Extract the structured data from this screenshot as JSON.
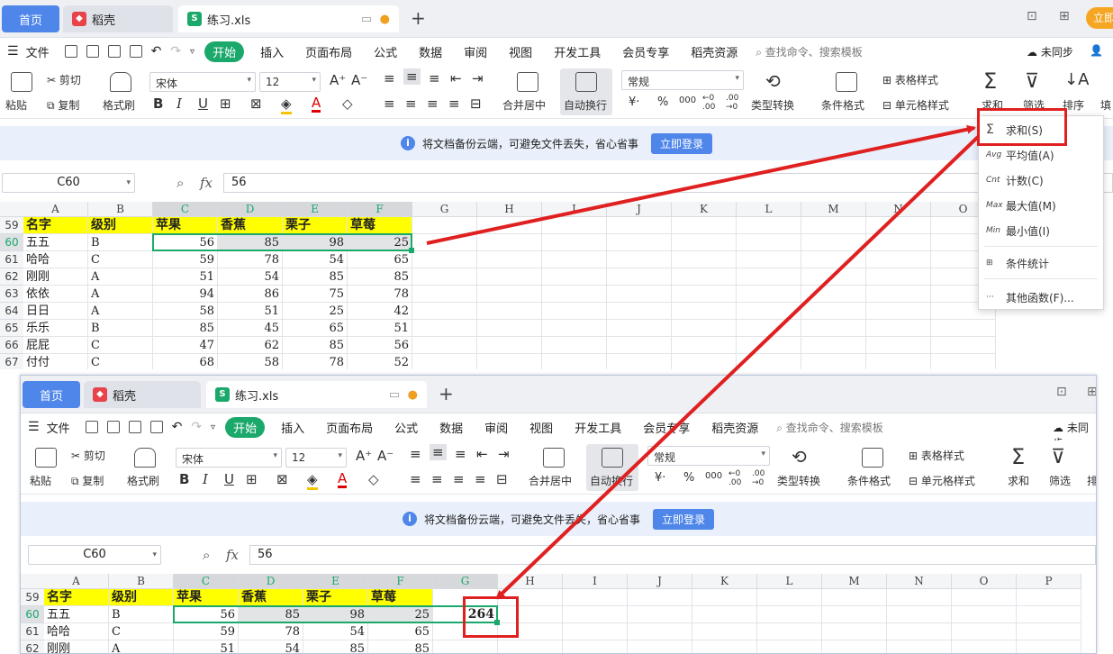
{
  "tabs": {
    "home": "首页",
    "daoke": "稻壳",
    "file": "练习.xls"
  },
  "menu": [
    "文件",
    "开始",
    "插入",
    "页面布局",
    "公式",
    "数据",
    "审阅",
    "视图",
    "开发工具",
    "会员专享",
    "稻壳资源"
  ],
  "menu_search": "查找命令、搜索模板",
  "sync_label": "未同步",
  "login_top": "立即",
  "ribbon": {
    "paste": "粘贴",
    "cut": "剪切",
    "copy": "复制",
    "format_painter": "格式刷",
    "font_name": "宋体",
    "font_size": "12",
    "merge_center": "合并居中",
    "wrap_text": "自动换行",
    "number_format": "常规",
    "type_convert": "类型转换",
    "cond_format": "条件格式",
    "table_style": "表格样式",
    "cell_style": "单元格样式",
    "sum": "求和",
    "filter": "筛选",
    "sort": "排序",
    "fill": "填"
  },
  "notice": {
    "text": "将文档备份云端，可避免文件丢失，省心省事",
    "button": "立即登录"
  },
  "formula_bar": {
    "cell_ref": "C60",
    "fx": "fx",
    "value": "56"
  },
  "columns": [
    "A",
    "B",
    "C",
    "D",
    "E",
    "F",
    "G",
    "H",
    "I",
    "J",
    "K",
    "L",
    "M",
    "N",
    "O"
  ],
  "columns2": [
    "A",
    "B",
    "C",
    "D",
    "E",
    "F",
    "G",
    "H",
    "I",
    "J",
    "K",
    "L",
    "M",
    "N",
    "O",
    "P"
  ],
  "header_row": {
    "num": "59",
    "cells": [
      "名字",
      "级别",
      "苹果",
      "香蕉",
      "栗子",
      "草莓"
    ]
  },
  "rows": [
    {
      "num": "60",
      "name": "五五",
      "level": "B",
      "vals": [
        "56",
        "85",
        "98",
        "25"
      ]
    },
    {
      "num": "61",
      "name": "哈哈",
      "level": "C",
      "vals": [
        "59",
        "78",
        "54",
        "65"
      ]
    },
    {
      "num": "62",
      "name": "刚刚",
      "level": "A",
      "vals": [
        "51",
        "54",
        "85",
        "85"
      ]
    },
    {
      "num": "63",
      "name": "依依",
      "level": "A",
      "vals": [
        "94",
        "86",
        "75",
        "78"
      ]
    },
    {
      "num": "64",
      "name": "日日",
      "level": "A",
      "vals": [
        "58",
        "51",
        "25",
        "42"
      ]
    },
    {
      "num": "65",
      "name": "乐乐",
      "level": "B",
      "vals": [
        "85",
        "45",
        "65",
        "51"
      ]
    },
    {
      "num": "66",
      "name": "屁屁",
      "level": "C",
      "vals": [
        "47",
        "62",
        "85",
        "56"
      ]
    },
    {
      "num": "67",
      "name": "付付",
      "level": "C",
      "vals": [
        "68",
        "58",
        "78",
        "52"
      ]
    }
  ],
  "sum_result": "264",
  "dropdown": [
    {
      "abbr": "Σ",
      "label": "求和(S)"
    },
    {
      "abbr": "Avg",
      "label": "平均值(A)"
    },
    {
      "abbr": "Cnt",
      "label": "计数(C)"
    },
    {
      "abbr": "Max",
      "label": "最大值(M)"
    },
    {
      "abbr": "Min",
      "label": "最小值(I)"
    },
    {
      "abbr": "⊞",
      "label": "条件统计"
    },
    {
      "abbr": "···",
      "label": "其他函数(F)..."
    }
  ],
  "colors": {
    "accent_green": "#1aa86b",
    "accent_blue": "#4f86ea",
    "annotation_red": "#e02020",
    "header_yellow": "#ffff00"
  }
}
